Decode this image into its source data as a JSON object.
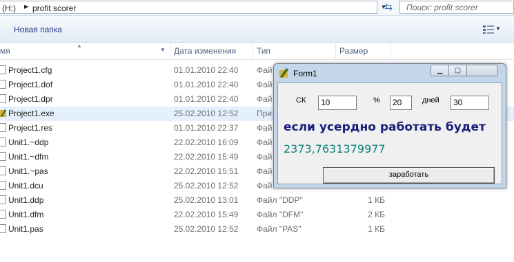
{
  "address": {
    "drive": "(H:)",
    "folder": "profit scorer"
  },
  "search": {
    "placeholder": "Поиск: profit scorer"
  },
  "toolbar": {
    "new_folder_label": "Новая папка"
  },
  "columns": {
    "name": "мя",
    "date": "Дата изменения",
    "type": "Тип",
    "size": "Размер"
  },
  "files": [
    {
      "name": "Project1.cfg",
      "date": "01.01.2010 22:40",
      "type": "Фай",
      "size": ""
    },
    {
      "name": "Project1.dof",
      "date": "01.01.2010 22:40",
      "type": "Фай",
      "size": ""
    },
    {
      "name": "Project1.dpr",
      "date": "01.01.2010 22:40",
      "type": "Фай",
      "size": ""
    },
    {
      "name": "Project1.exe",
      "date": "25.02.2010 12:52",
      "type": "При",
      "size": ""
    },
    {
      "name": "Project1.res",
      "date": "01.01.2010 22:37",
      "type": "Фай",
      "size": ""
    },
    {
      "name": "Unit1.~ddp",
      "date": "22.02.2010 16:09",
      "type": "Фай",
      "size": ""
    },
    {
      "name": "Unit1.~dfm",
      "date": "22.02.2010 15:49",
      "type": "Фай",
      "size": ""
    },
    {
      "name": "Unit1.~pas",
      "date": "22.02.2010 15:51",
      "type": "Фай",
      "size": ""
    },
    {
      "name": "Unit1.dcu",
      "date": "25.02.2010 12:52",
      "type": "Фай",
      "size": ""
    },
    {
      "name": "Unit1.ddp",
      "date": "25.02.2010 13:01",
      "type": "Файл \"DDP\"",
      "size": "1 КБ"
    },
    {
      "name": "Unit1.dfm",
      "date": "22.02.2010 15:49",
      "type": "Файл \"DFM\"",
      "size": "2 КБ"
    },
    {
      "name": "Unit1.pas",
      "date": "25.02.2010 12:52",
      "type": "Файл \"PAS\"",
      "size": "1 КБ"
    }
  ],
  "form1": {
    "title": "Form1",
    "ck_label": "СК",
    "ck_value": "10",
    "percent_label": "%",
    "percent_value": "20",
    "days_label": "дней",
    "days_value": "30",
    "message": "если усердно работать будет",
    "result": "2373,7631379977",
    "button_label": "заработать"
  },
  "colors": {
    "selection": "#e4f0fb",
    "message": "#1b1f7a",
    "result": "#0b7f7f"
  }
}
